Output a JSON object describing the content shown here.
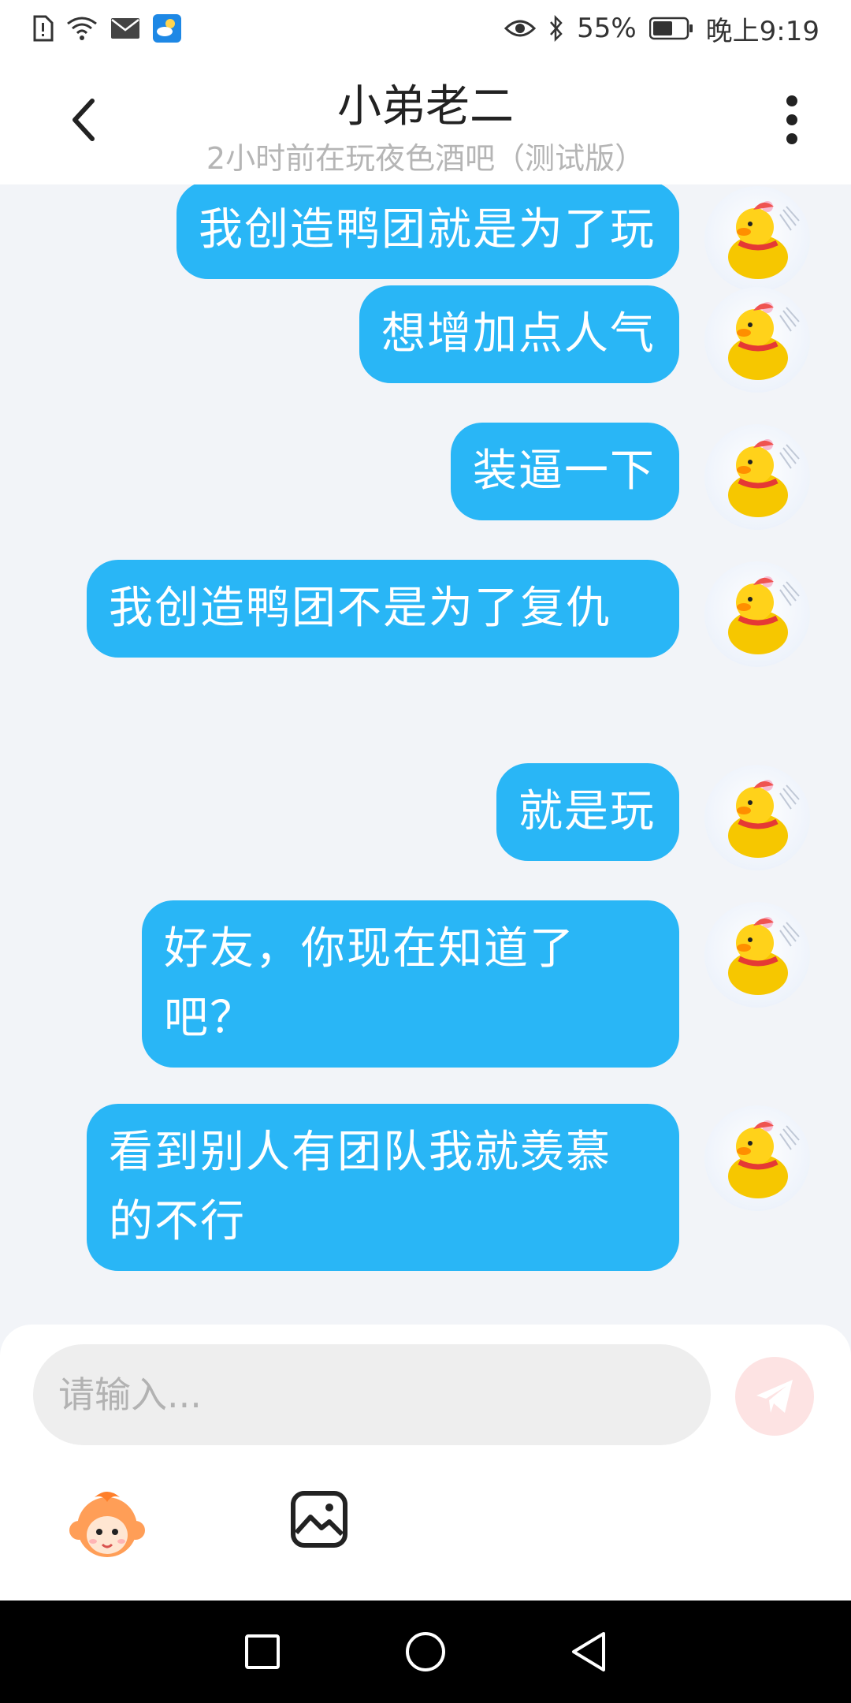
{
  "status_bar": {
    "battery": "55%",
    "time": "晚上9:19",
    "icons": [
      "sim-alert-icon",
      "wifi-icon",
      "mail-icon",
      "weather-app-icon",
      "eye-icon",
      "bluetooth-icon",
      "battery-icon"
    ]
  },
  "header": {
    "title": "小弟老二",
    "subtitle": "2小时前在玩夜色酒吧（测试版）"
  },
  "messages": [
    {
      "text": "我创造鸭团就是为了玩",
      "from": "self"
    },
    {
      "text": "想增加点人气",
      "from": "self"
    },
    {
      "text": "装逼一下",
      "from": "self"
    },
    {
      "text": "我创造鸭团不是为了复仇",
      "from": "self"
    },
    {
      "text": "就是玩",
      "from": "self"
    },
    {
      "text": "好友，你现在知道了吧？",
      "from": "self"
    },
    {
      "text": "看到别人有团队我就羡慕的不行",
      "from": "self"
    }
  ],
  "composer": {
    "placeholder": "请输入..."
  },
  "colors": {
    "bubble": "#29b6f6",
    "send_button": "#fde3e3",
    "background": "#f2f4f8"
  }
}
